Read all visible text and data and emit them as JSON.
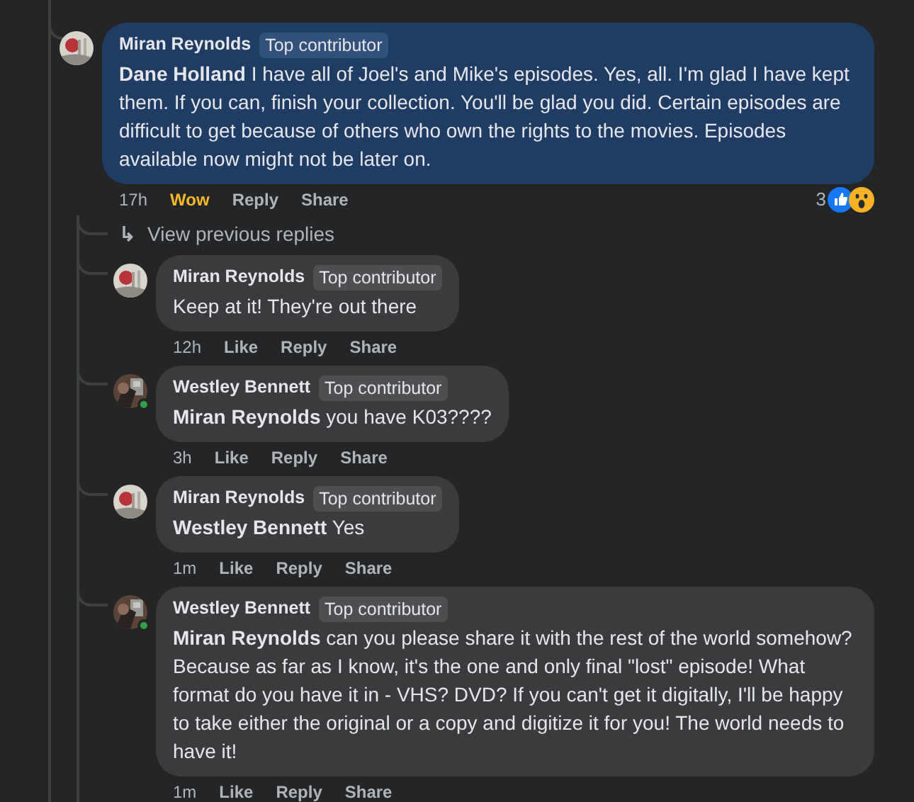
{
  "comment": {
    "author": "Miran Reynolds",
    "badge": "Top contributor",
    "online": false,
    "highlighted": true,
    "mention": "Dane Holland",
    "text": "I have all of Joel's and Mike's episodes. Yes, all. I'm glad I have kept them. If you can, finish your collection. You'll be glad you did. Certain episodes are difficult to get because of others who own the rights to the movies. Episodes available now might not be later on.",
    "time": "17h",
    "reaction": {
      "label": "Wow",
      "selected": true
    },
    "actions": [
      "Reply",
      "Share"
    ],
    "reaction_count": "3",
    "view_previous": {
      "arrow": "↳",
      "label": "View previous replies"
    },
    "children": [
      {
        "author": "Miran Reynolds",
        "badge": "Top contributor",
        "online": false,
        "highlighted": false,
        "text": "Keep at it! They're out there",
        "time": "12h",
        "reaction": {
          "label": "Like",
          "selected": false
        },
        "actions": [
          "Reply",
          "Share"
        ]
      },
      {
        "author": "Westley Bennett",
        "badge": "Top contributor",
        "online": true,
        "highlighted": false,
        "mention": "Miran Reynolds",
        "text": "you have K03????",
        "time": "3h",
        "reaction": {
          "label": "Like",
          "selected": false
        },
        "actions": [
          "Reply",
          "Share"
        ]
      },
      {
        "author": "Miran Reynolds",
        "badge": "Top contributor",
        "online": false,
        "highlighted": false,
        "mention": "Westley Bennett",
        "text": "Yes",
        "time": "1m",
        "reaction": {
          "label": "Like",
          "selected": false
        },
        "actions": [
          "Reply",
          "Share"
        ]
      },
      {
        "author": "Westley Bennett",
        "badge": "Top contributor",
        "online": true,
        "highlighted": false,
        "mention": "Miran Reynolds",
        "text": "can you please share it with the rest of the world somehow? Because as far as I know, it's the one and only final \"lost\" episode! What format do you have it in - VHS? DVD? If you can't get it digitally, I'll be happy to take either the original or a copy and digitize it for you! The world needs to have it!",
        "time": "1m",
        "reaction": {
          "label": "Like",
          "selected": false
        },
        "actions": [
          "Reply",
          "Share"
        ]
      }
    ]
  }
}
